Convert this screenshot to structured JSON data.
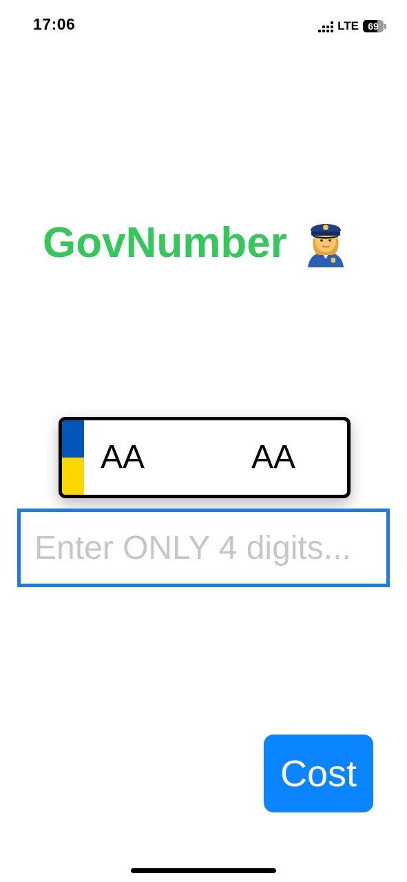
{
  "status_bar": {
    "time": "17:06",
    "network": "LTE",
    "battery_level": "69",
    "battery_fraction": 0.69,
    "icons": [
      "signal-icon",
      "battery-icon"
    ]
  },
  "title": {
    "text": "GovNumber",
    "icon": "police-officer-icon"
  },
  "plate": {
    "left_letters": "AA",
    "right_letters": "AA",
    "flag_colors": [
      "#0057b8",
      "#ffd700"
    ]
  },
  "input": {
    "value": "",
    "placeholder": "Enter ONLY 4 digits..."
  },
  "cost_button": {
    "label": "Cost"
  },
  "colors": {
    "title": "#34c759",
    "accent": "#0a84ff",
    "input_border": "#1b7be8",
    "placeholder": "#c6c6c8"
  }
}
